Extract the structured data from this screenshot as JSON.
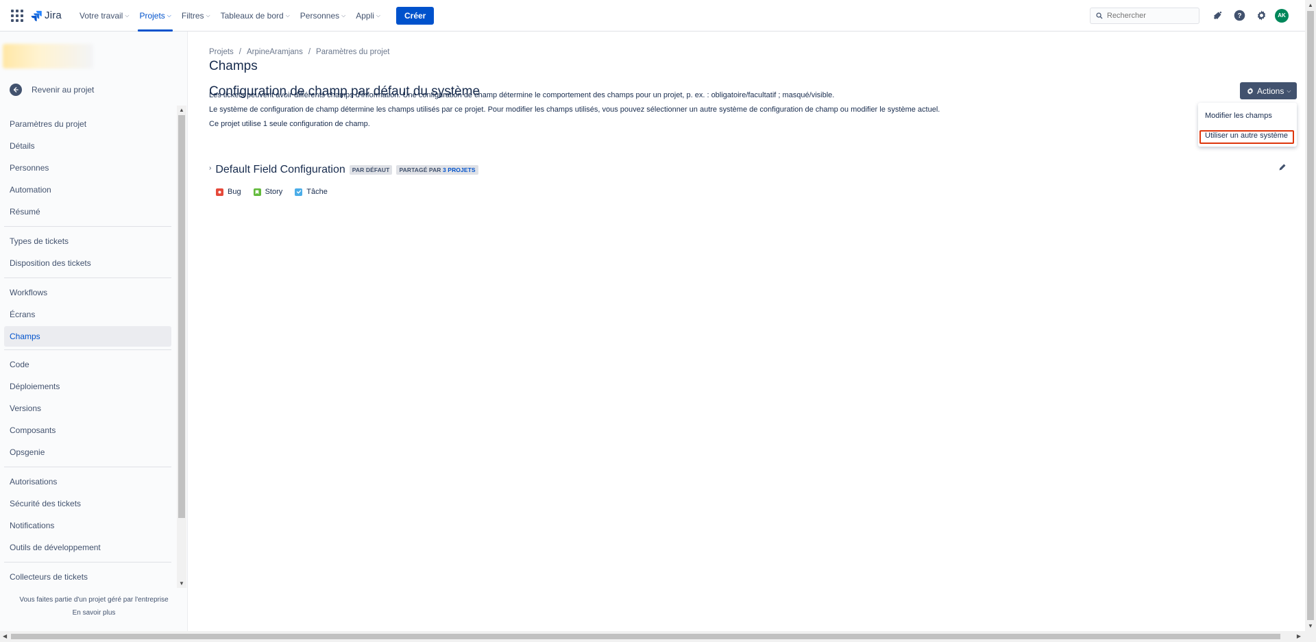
{
  "topbar": {
    "logo_text": "Jira",
    "nav": [
      {
        "label": "Votre travail",
        "has_dropdown": true
      },
      {
        "label": "Projets",
        "has_dropdown": true,
        "active": true
      },
      {
        "label": "Filtres",
        "has_dropdown": true
      },
      {
        "label": "Tableaux de bord",
        "has_dropdown": true
      },
      {
        "label": "Personnes",
        "has_dropdown": true
      },
      {
        "label": "Appli",
        "has_dropdown": true
      }
    ],
    "create_label": "Créer",
    "search_placeholder": "Rechercher",
    "avatar_initials": "AK",
    "accent_color": "#0052cc"
  },
  "sidebar": {
    "back_label": "Revenir au projet",
    "groups": [
      [
        "Paramètres du projet",
        "Détails",
        "Personnes",
        "Automation",
        "Résumé"
      ],
      [
        "Types de tickets",
        "Disposition des tickets"
      ],
      [
        "Workflows",
        "Écrans",
        "Champs"
      ],
      [
        "Code",
        "Déploiements",
        "Versions",
        "Composants",
        "Opsgenie"
      ],
      [
        "Autorisations",
        "Sécurité des tickets",
        "Notifications",
        "Outils de développement"
      ],
      [
        "Collecteurs de tickets"
      ]
    ],
    "selected": "Champs",
    "footer_text": "Vous faites partie d'un projet géré par l'entreprise",
    "footer_link": "En savoir plus"
  },
  "main": {
    "breadcrumb": [
      "Projets",
      "ArpineAramjans",
      "Paramètres du projet"
    ],
    "page_title": "Champs",
    "section_title": "Configuration de champ par défaut du système",
    "paragraphs": [
      "Les tickets peuvent avoir différents champs d'information. Une configuration de champ détermine le comportement des champs pour un projet, p. ex. : obligatoire/facultatif ; masqué/visible.",
      "Le système de configuration de champ détermine les champs utilisés par ce projet. Pour modifier les champs utilisés, vous pouvez sélectionner un autre système de configuration de champ ou modifier le système actuel.",
      "Ce projet utilise 1 seule configuration de champ."
    ],
    "actions_label": "Actions",
    "actions_menu": [
      "Modifier les champs",
      "Utiliser un autre système"
    ],
    "field_config": {
      "name": "Default Field Configuration",
      "default_badge": "PAR DÉFAUT",
      "shared_prefix": "PARTAGÉ PAR",
      "shared_count": "3 PROJETS"
    },
    "issue_types": [
      {
        "name": "Bug",
        "color": "#e5493a"
      },
      {
        "name": "Story",
        "color": "#63ba3c"
      },
      {
        "name": "Tâche",
        "color": "#4bade8"
      }
    ]
  }
}
